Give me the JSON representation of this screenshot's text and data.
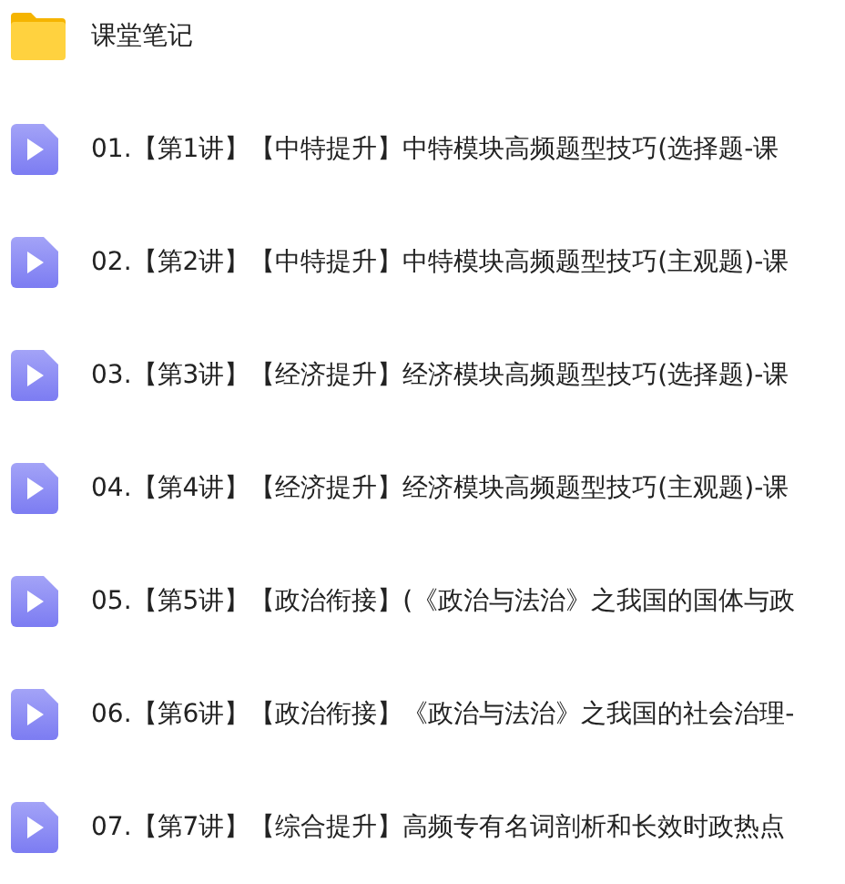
{
  "items": [
    {
      "kind": "folder",
      "name": "课堂笔记"
    },
    {
      "kind": "video",
      "name": "01.【第1讲】【中特提升】中特模块高频题型技巧(选择题-课"
    },
    {
      "kind": "video",
      "name": "02.【第2讲】【中特提升】中特模块高频题型技巧(主观题)-课"
    },
    {
      "kind": "video",
      "name": "03.【第3讲】【经济提升】经济模块高频题型技巧(选择题)-课"
    },
    {
      "kind": "video",
      "name": "04.【第4讲】【经济提升】经济模块高频题型技巧(主观题)-课"
    },
    {
      "kind": "video",
      "name": "05.【第5讲】【政治衔接】(《政治与法治》之我国的国体与政"
    },
    {
      "kind": "video",
      "name": "06.【第6讲】【政治衔接】《政治与法治》之我国的社会治理-"
    },
    {
      "kind": "video",
      "name": "07.【第7讲】【综合提升】高频专有名词剖析和长效时政热点"
    }
  ]
}
